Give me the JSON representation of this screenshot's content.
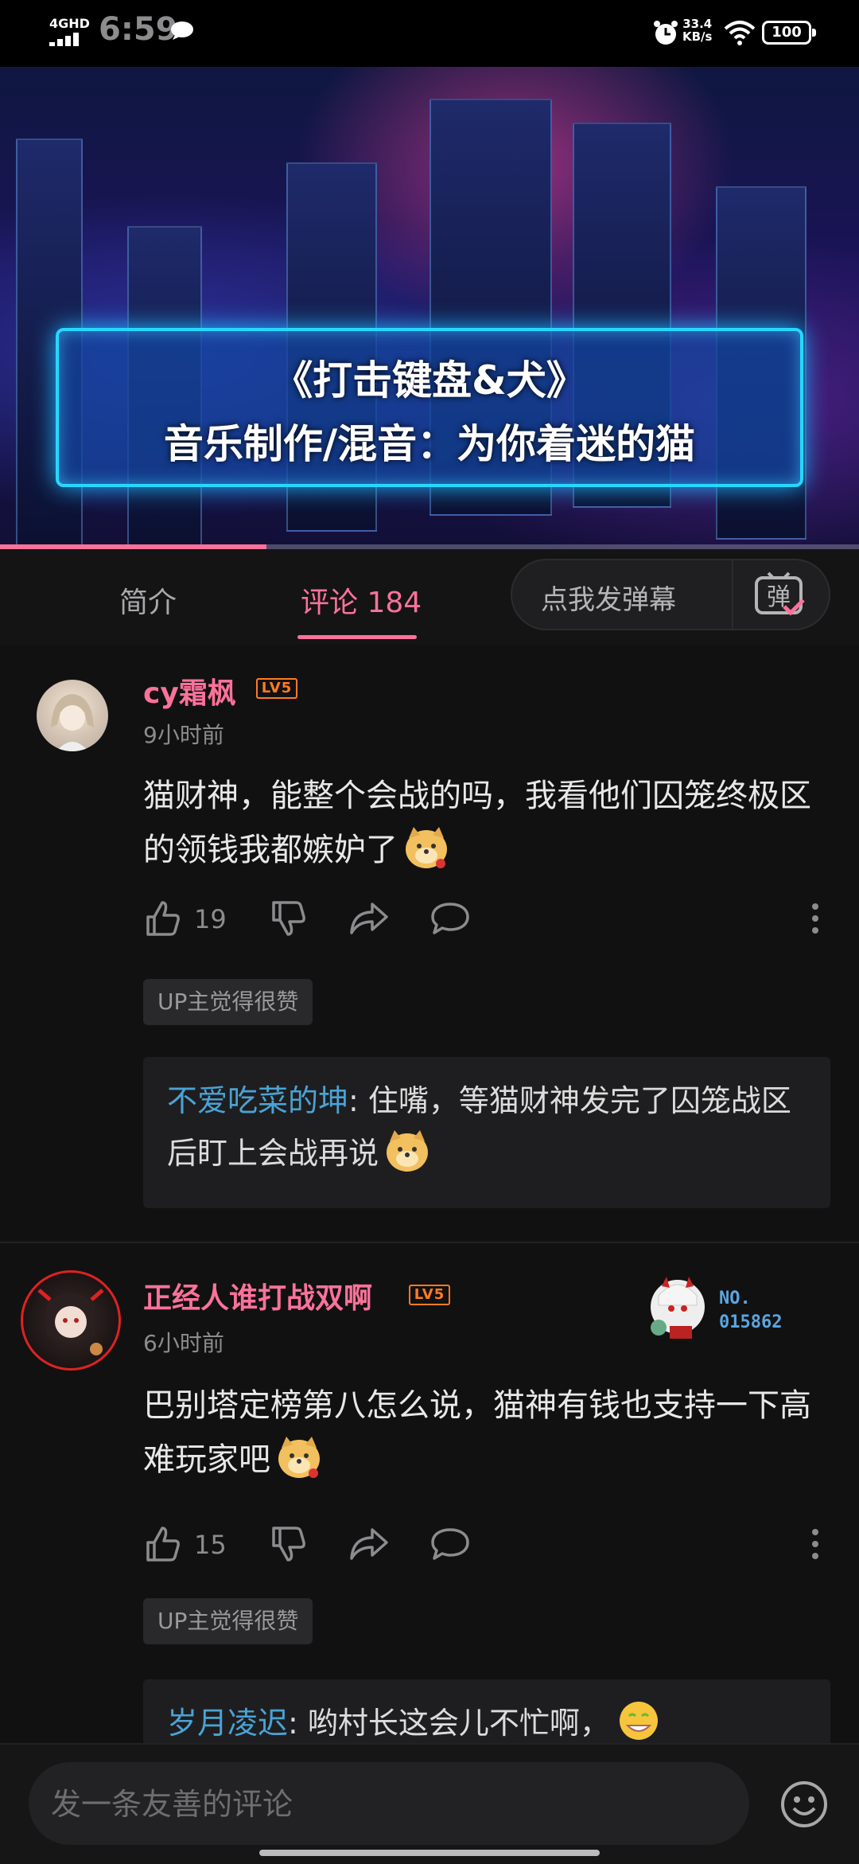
{
  "status_bar": {
    "network": "4GHD",
    "time": "6:59",
    "speed_value": "33.4",
    "speed_unit": "KB/s",
    "battery": "100"
  },
  "video": {
    "title_line1": "《打击键盘&犬》",
    "title_line2": "音乐制作/混音：为你着迷的猫",
    "progress_fraction": 0.31
  },
  "tabs": {
    "intro": "简介",
    "comments": "评论 184",
    "danmaku_placeholder": "点我发弹幕",
    "danmaku_icon_char": "弹"
  },
  "comments": [
    {
      "username": "cy霜枫",
      "level": "LV5",
      "time": "9小时前",
      "text": "猫财神，能整个会战的吗，我看他们囚笼终极区的领钱我都嫉妒了",
      "likes": "19",
      "up_badge": "UP主觉得很赞",
      "reply": {
        "name": "不爱吃菜的坤",
        "text": ": 住嘴，等猫财神发完了囚笼战区后盯上会战再说"
      }
    },
    {
      "username": "正经人谁打战双啊",
      "level": "LV5",
      "time": "6小时前",
      "text": "巴别塔定榜第八怎么说，猫神有钱也支持一下高难玩家吧",
      "likes": "15",
      "up_badge": "UP主觉得很赞",
      "fan_badge_line1": "NO.",
      "fan_badge_line2": "015862",
      "reply": {
        "name": "岁月凌迟",
        "text": ": 哟村长这会儿不忙啊，"
      }
    }
  ],
  "bottom": {
    "input_placeholder": "发一条友善的评论"
  },
  "colors": {
    "accent": "#fb7299",
    "level": "#ff7b22",
    "reply_name": "#4aa3d4",
    "background": "#111112"
  }
}
